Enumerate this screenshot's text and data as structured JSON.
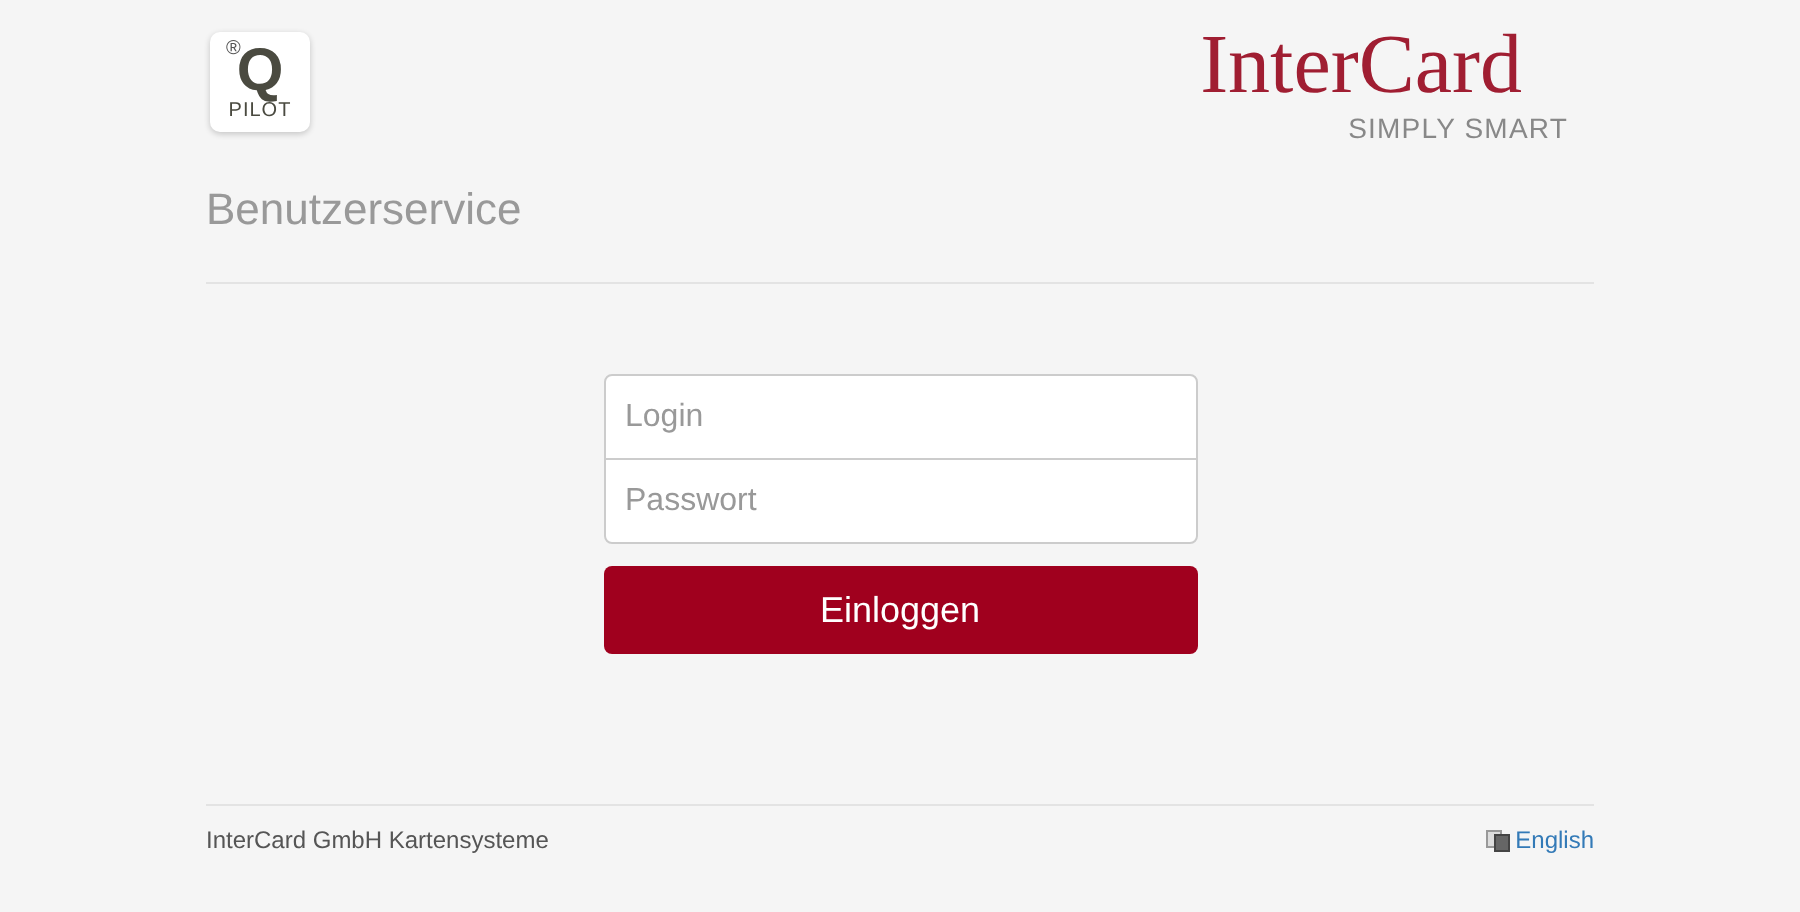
{
  "header": {
    "app_logo": {
      "mark": "®",
      "letter": "Q",
      "name": "PILOT"
    },
    "brand_logo": {
      "name": "InterCard",
      "tagline": "SIMPLY SMART"
    },
    "title": "Benutzerservice"
  },
  "login_form": {
    "fields": [
      {
        "placeholder": "Login"
      },
      {
        "placeholder": "Passwort"
      }
    ],
    "submit": "Einloggen"
  },
  "footer": {
    "company": "InterCard GmbH Kartensysteme",
    "language_link": "English"
  }
}
